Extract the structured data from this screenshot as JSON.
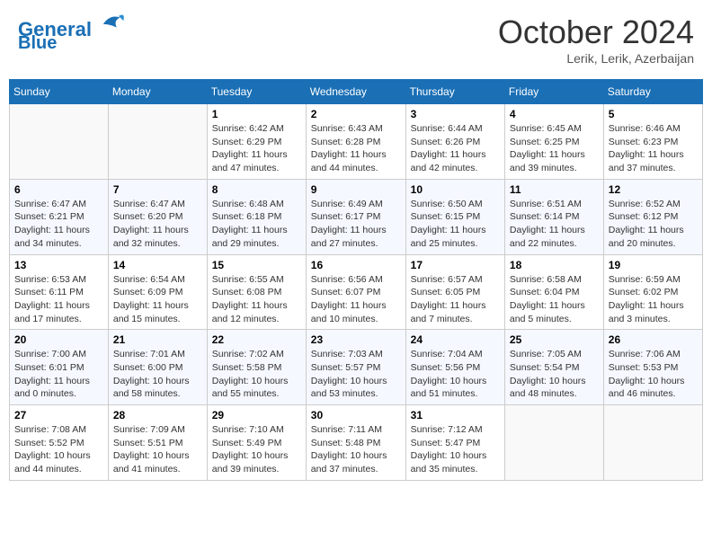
{
  "header": {
    "logo_line1": "General",
    "logo_line2": "Blue",
    "month": "October 2024",
    "location": "Lerik, Lerik, Azerbaijan"
  },
  "weekdays": [
    "Sunday",
    "Monday",
    "Tuesday",
    "Wednesday",
    "Thursday",
    "Friday",
    "Saturday"
  ],
  "weeks": [
    [
      {
        "day": "",
        "info": ""
      },
      {
        "day": "",
        "info": ""
      },
      {
        "day": "1",
        "info": "Sunrise: 6:42 AM\nSunset: 6:29 PM\nDaylight: 11 hours and 47 minutes."
      },
      {
        "day": "2",
        "info": "Sunrise: 6:43 AM\nSunset: 6:28 PM\nDaylight: 11 hours and 44 minutes."
      },
      {
        "day": "3",
        "info": "Sunrise: 6:44 AM\nSunset: 6:26 PM\nDaylight: 11 hours and 42 minutes."
      },
      {
        "day": "4",
        "info": "Sunrise: 6:45 AM\nSunset: 6:25 PM\nDaylight: 11 hours and 39 minutes."
      },
      {
        "day": "5",
        "info": "Sunrise: 6:46 AM\nSunset: 6:23 PM\nDaylight: 11 hours and 37 minutes."
      }
    ],
    [
      {
        "day": "6",
        "info": "Sunrise: 6:47 AM\nSunset: 6:21 PM\nDaylight: 11 hours and 34 minutes."
      },
      {
        "day": "7",
        "info": "Sunrise: 6:47 AM\nSunset: 6:20 PM\nDaylight: 11 hours and 32 minutes."
      },
      {
        "day": "8",
        "info": "Sunrise: 6:48 AM\nSunset: 6:18 PM\nDaylight: 11 hours and 29 minutes."
      },
      {
        "day": "9",
        "info": "Sunrise: 6:49 AM\nSunset: 6:17 PM\nDaylight: 11 hours and 27 minutes."
      },
      {
        "day": "10",
        "info": "Sunrise: 6:50 AM\nSunset: 6:15 PM\nDaylight: 11 hours and 25 minutes."
      },
      {
        "day": "11",
        "info": "Sunrise: 6:51 AM\nSunset: 6:14 PM\nDaylight: 11 hours and 22 minutes."
      },
      {
        "day": "12",
        "info": "Sunrise: 6:52 AM\nSunset: 6:12 PM\nDaylight: 11 hours and 20 minutes."
      }
    ],
    [
      {
        "day": "13",
        "info": "Sunrise: 6:53 AM\nSunset: 6:11 PM\nDaylight: 11 hours and 17 minutes."
      },
      {
        "day": "14",
        "info": "Sunrise: 6:54 AM\nSunset: 6:09 PM\nDaylight: 11 hours and 15 minutes."
      },
      {
        "day": "15",
        "info": "Sunrise: 6:55 AM\nSunset: 6:08 PM\nDaylight: 11 hours and 12 minutes."
      },
      {
        "day": "16",
        "info": "Sunrise: 6:56 AM\nSunset: 6:07 PM\nDaylight: 11 hours and 10 minutes."
      },
      {
        "day": "17",
        "info": "Sunrise: 6:57 AM\nSunset: 6:05 PM\nDaylight: 11 hours and 7 minutes."
      },
      {
        "day": "18",
        "info": "Sunrise: 6:58 AM\nSunset: 6:04 PM\nDaylight: 11 hours and 5 minutes."
      },
      {
        "day": "19",
        "info": "Sunrise: 6:59 AM\nSunset: 6:02 PM\nDaylight: 11 hours and 3 minutes."
      }
    ],
    [
      {
        "day": "20",
        "info": "Sunrise: 7:00 AM\nSunset: 6:01 PM\nDaylight: 11 hours and 0 minutes."
      },
      {
        "day": "21",
        "info": "Sunrise: 7:01 AM\nSunset: 6:00 PM\nDaylight: 10 hours and 58 minutes."
      },
      {
        "day": "22",
        "info": "Sunrise: 7:02 AM\nSunset: 5:58 PM\nDaylight: 10 hours and 55 minutes."
      },
      {
        "day": "23",
        "info": "Sunrise: 7:03 AM\nSunset: 5:57 PM\nDaylight: 10 hours and 53 minutes."
      },
      {
        "day": "24",
        "info": "Sunrise: 7:04 AM\nSunset: 5:56 PM\nDaylight: 10 hours and 51 minutes."
      },
      {
        "day": "25",
        "info": "Sunrise: 7:05 AM\nSunset: 5:54 PM\nDaylight: 10 hours and 48 minutes."
      },
      {
        "day": "26",
        "info": "Sunrise: 7:06 AM\nSunset: 5:53 PM\nDaylight: 10 hours and 46 minutes."
      }
    ],
    [
      {
        "day": "27",
        "info": "Sunrise: 7:08 AM\nSunset: 5:52 PM\nDaylight: 10 hours and 44 minutes."
      },
      {
        "day": "28",
        "info": "Sunrise: 7:09 AM\nSunset: 5:51 PM\nDaylight: 10 hours and 41 minutes."
      },
      {
        "day": "29",
        "info": "Sunrise: 7:10 AM\nSunset: 5:49 PM\nDaylight: 10 hours and 39 minutes."
      },
      {
        "day": "30",
        "info": "Sunrise: 7:11 AM\nSunset: 5:48 PM\nDaylight: 10 hours and 37 minutes."
      },
      {
        "day": "31",
        "info": "Sunrise: 7:12 AM\nSunset: 5:47 PM\nDaylight: 10 hours and 35 minutes."
      },
      {
        "day": "",
        "info": ""
      },
      {
        "day": "",
        "info": ""
      }
    ]
  ]
}
